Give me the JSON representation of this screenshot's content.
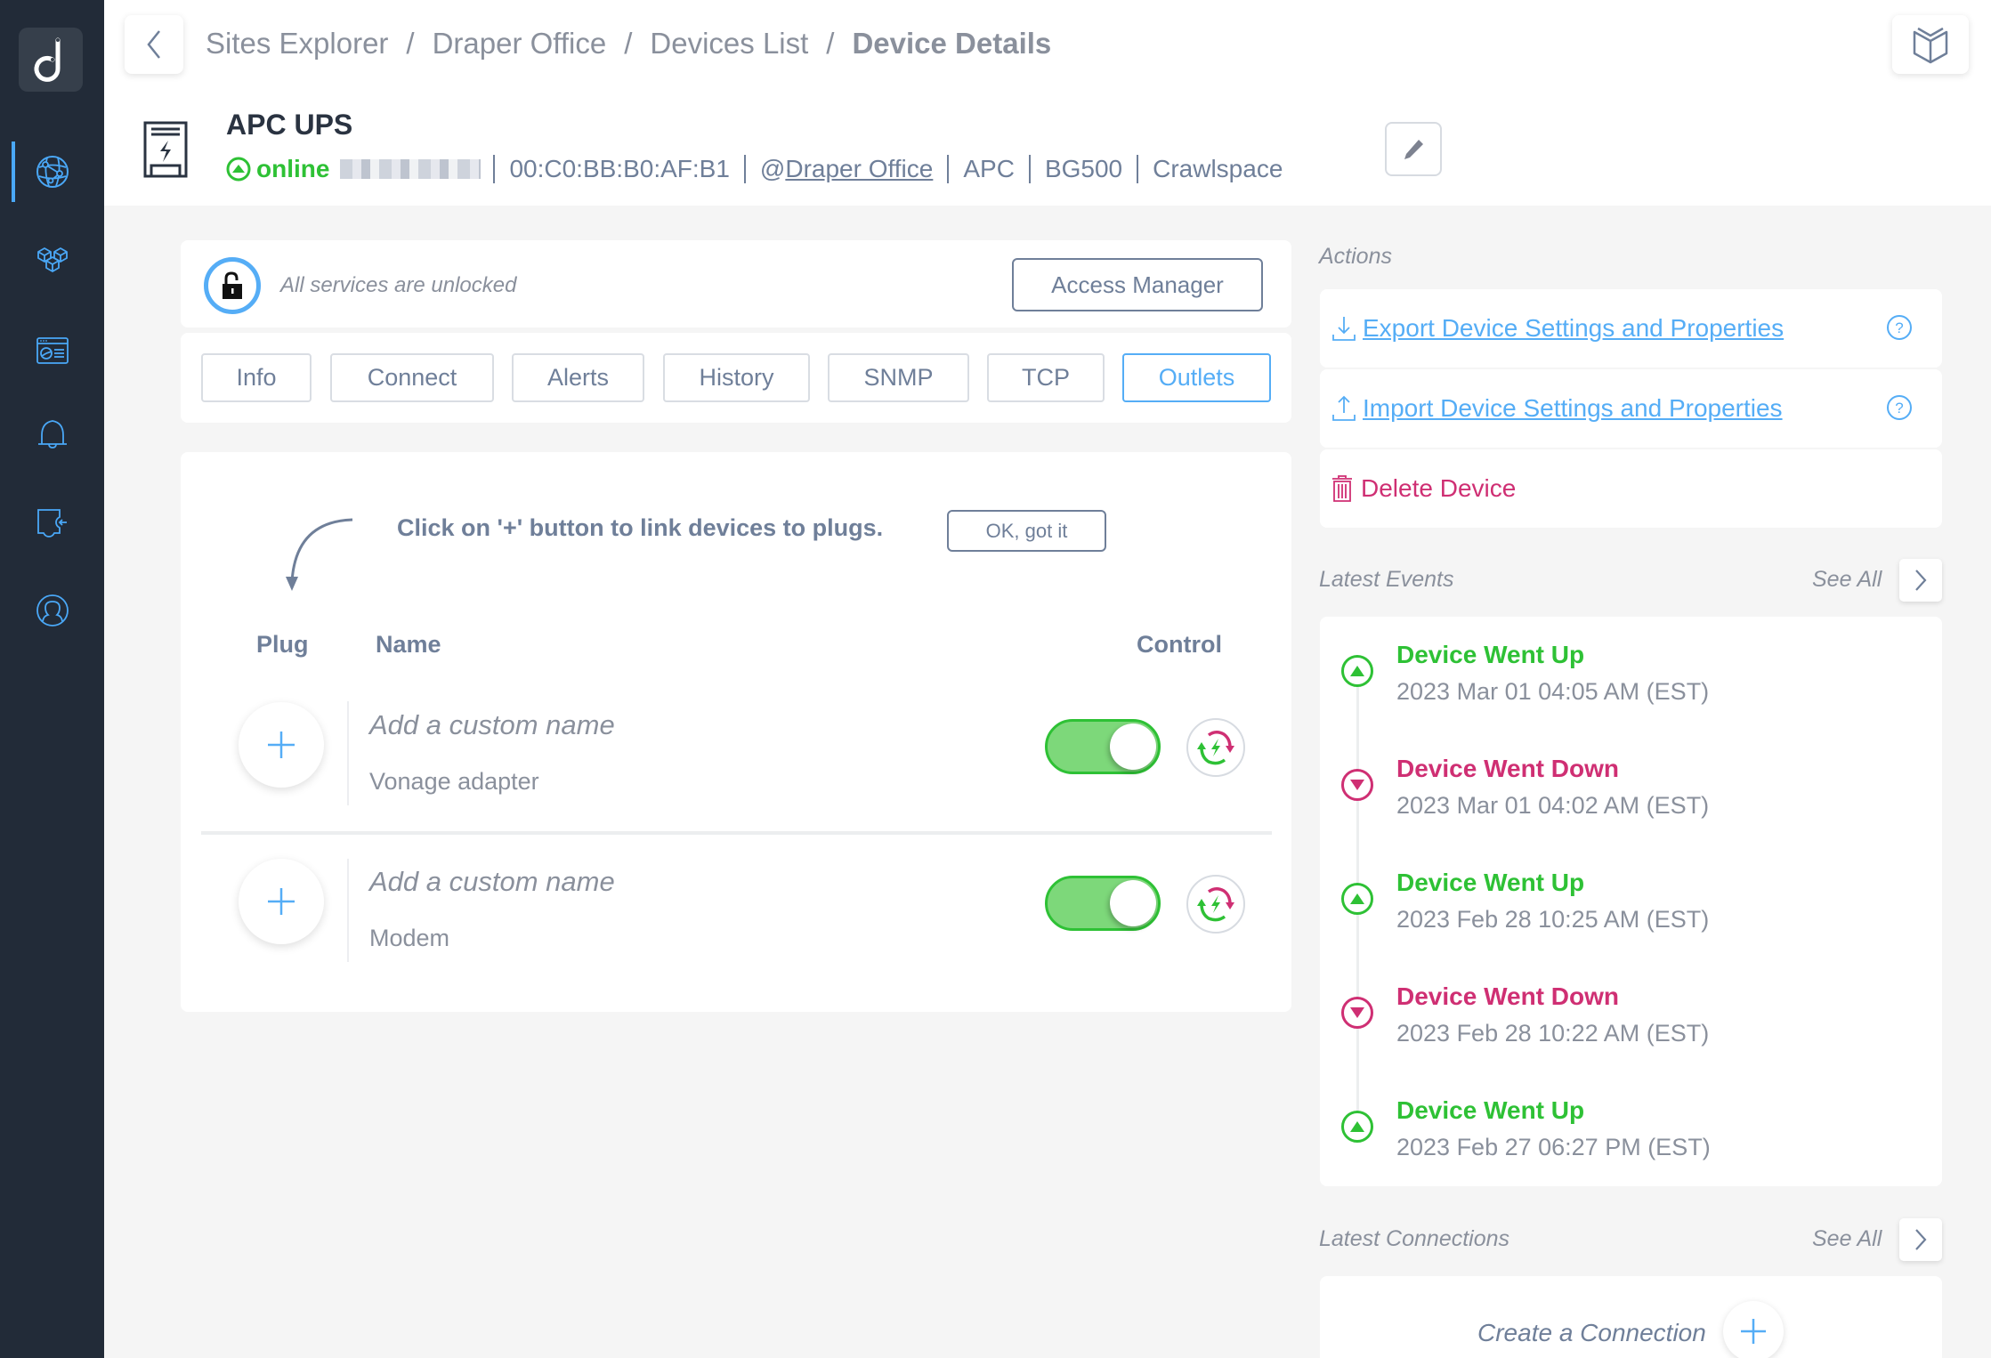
{
  "sidebar": {
    "logo": "d",
    "items": [
      {
        "name": "sites",
        "icon": "globe-network-icon",
        "active": true
      },
      {
        "name": "devices",
        "icon": "cubes-icon",
        "active": false
      },
      {
        "name": "dashboard",
        "icon": "dashboard-window-icon",
        "active": false
      },
      {
        "name": "alerts",
        "icon": "bell-icon",
        "active": false
      },
      {
        "name": "integrations",
        "icon": "puzzle-plugin-icon",
        "active": false
      },
      {
        "name": "account",
        "icon": "user-circle-icon",
        "active": false
      }
    ]
  },
  "header": {
    "breadcrumb": [
      "Sites Explorer",
      "Draper Office",
      "Devices List"
    ],
    "breadcrumb_current": "Device Details",
    "separator": "/"
  },
  "device": {
    "name": "APC UPS",
    "status": "online",
    "mac": "00:C0:BB:B0:AF:B1",
    "site_prefix": "@",
    "site": "Draper Office",
    "vendor": "APC",
    "model": "BG500",
    "location": "Crawlspace"
  },
  "access": {
    "text": "All services are unlocked",
    "button": "Access Manager"
  },
  "tabs": [
    {
      "label": "Info",
      "active": false
    },
    {
      "label": "Connect",
      "active": false
    },
    {
      "label": "Alerts",
      "active": false
    },
    {
      "label": "History",
      "active": false
    },
    {
      "label": "SNMP",
      "active": false
    },
    {
      "label": "TCP",
      "active": false
    },
    {
      "label": "Outlets",
      "active": true
    }
  ],
  "outlets": {
    "hint": "Click on '+' button to link devices to plugs.",
    "hint_button": "OK, got it",
    "columns": {
      "plug": "Plug",
      "name": "Name",
      "control": "Control"
    },
    "rows": [
      {
        "placeholder": "Add a custom name",
        "device": "Vonage adapter",
        "on": true
      },
      {
        "placeholder": "Add a custom name",
        "device": "Modem",
        "on": true
      }
    ]
  },
  "actions": {
    "label": "Actions",
    "export": "Export Device Settings and Properties",
    "import": "Import Device Settings and Properties",
    "delete": "Delete Device"
  },
  "events": {
    "label": "Latest Events",
    "see_all": "See All",
    "items": [
      {
        "title": "Device Went Up",
        "time": "2023 Mar 01 04:05 AM (EST)",
        "type": "up"
      },
      {
        "title": "Device Went Down",
        "time": "2023 Mar 01 04:02 AM (EST)",
        "type": "down"
      },
      {
        "title": "Device Went Up",
        "time": "2023 Feb 28 10:25 AM (EST)",
        "type": "up"
      },
      {
        "title": "Device Went Down",
        "time": "2023 Feb 28 10:22 AM (EST)",
        "type": "down"
      },
      {
        "title": "Device Went Up",
        "time": "2023 Feb 27 06:27 PM (EST)",
        "type": "up"
      }
    ]
  },
  "connections": {
    "label": "Latest Connections",
    "see_all": "See All",
    "create": "Create a Connection"
  },
  "colors": {
    "sidebar_bg": "#222b38",
    "accent": "#55adf6",
    "up": "#2ec135",
    "down": "#cf2f73",
    "text": "#6f7f99"
  }
}
